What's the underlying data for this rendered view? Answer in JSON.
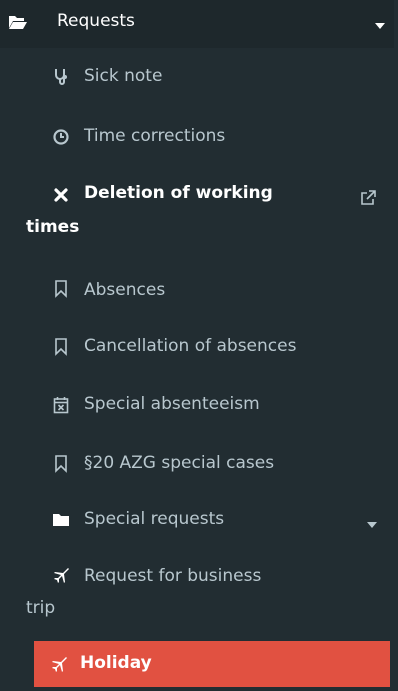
{
  "menu": {
    "header": {
      "label": "Requests",
      "icon": "folder-open-icon",
      "caret": "caret-down-icon"
    },
    "items": [
      {
        "label": "Sick note",
        "icon": "stethoscope-icon"
      },
      {
        "label": "Time corrections",
        "icon": "clock-icon"
      },
      {
        "label": "Deletion of working",
        "label_cont": "times",
        "icon": "times-icon",
        "external": "external-link-icon"
      },
      {
        "label": "Absences",
        "icon": "bookmark-icon"
      },
      {
        "label": "Cancellation of absences",
        "icon": "bookmark-icon"
      },
      {
        "label": "Special absenteeism",
        "icon": "calendar-times-icon"
      },
      {
        "label": "§20 AZG special cases",
        "icon": "bookmark-icon"
      },
      {
        "label": "Special requests",
        "icon": "folder-icon",
        "caret": "caret-down-icon"
      },
      {
        "label": "Request for business",
        "label_cont": "trip",
        "icon": "plane-icon"
      },
      {
        "label": "Holiday",
        "icon": "plane-icon",
        "active": true
      }
    ]
  },
  "colors": {
    "sidebar_bg": "#222d32",
    "header_bg": "#1e282c",
    "text": "#b8c7ce",
    "text_active": "#ffffff",
    "active_bg": "#e15141"
  }
}
